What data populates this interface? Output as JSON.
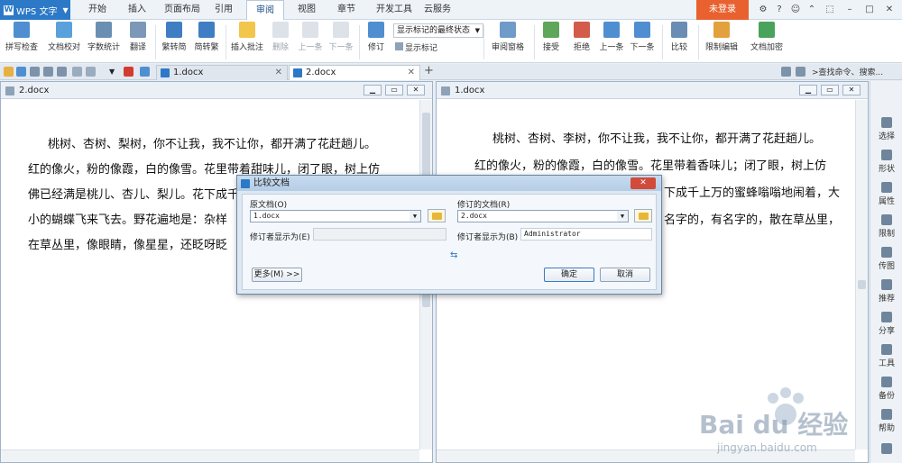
{
  "app": {
    "name": "WPS 文字",
    "login": "未登录"
  },
  "menu": [
    "开始",
    "插入",
    "页面布局",
    "引用",
    "审阅",
    "视图",
    "章节",
    "开发工具",
    "云服务"
  ],
  "menu_active": "审阅",
  "ribbon": {
    "spellcheck": "拼写检查",
    "doc_check": "文档校对",
    "word_count": "字数统计",
    "translate": "翻译",
    "to_simplified": "繁转简",
    "to_traditional": "简转繁",
    "insert_comment": "插入批注",
    "delete": "删除",
    "prev": "上一条",
    "next": "下一条",
    "track": "修订",
    "show_select": "显示标记的最终状态",
    "show_marks": "显示标记",
    "review_pane": "审阅窗格",
    "accept": "接受",
    "reject": "拒绝",
    "prev2": "上一条",
    "next2": "下一条",
    "compare": "比较",
    "restrict": "限制编辑",
    "encrypt": "文档加密"
  },
  "tabs": {
    "doc1": "1.docx",
    "doc2": "2.docx",
    "search": ">查找命令、搜索..."
  },
  "left_pane": {
    "title": "2.docx",
    "lines": [
      "桃树、杏树、梨树，你不让我，我不让你，都开满了花赶趟儿。",
      "红的像火，粉的像霞，白的像雪。花里带着甜味儿，闭了眼，树上仿",
      "佛已经满是桃儿、杏儿、梨儿。花下成千",
      "小的蝴蝶飞来飞去。野花遍地是：杂样",
      "在草丛里，像眼睛，像星星，还眨呀眨"
    ]
  },
  "right_pane": {
    "title": "1.docx",
    "lines": [
      "桃树、杏树、李树，你不让我，我不让你，都开满了花赶趟儿。",
      "红的像火，粉的像霞，白的像雪。花里带着香味儿；闭了眼，树上仿",
      "下成千上万的蜜蜂嗡嗡地闹着，大",
      "名字的，有名字的，散在草丛里，"
    ]
  },
  "sidepanel": [
    "选择",
    "形状",
    "属性",
    "限制",
    "传图",
    "推荐",
    "分享",
    "工具",
    "备份",
    "帮助"
  ],
  "dialog": {
    "title": "比较文档",
    "orig_label": "原文档(O)",
    "orig_value": "1.docx",
    "revised_label": "修订的文档(R)",
    "revised_value": "2.docx",
    "orig_author_label": "修订者显示为(E)",
    "orig_author_value": "",
    "revised_author_label": "修订者显示为(B)",
    "revised_author_value": "Administrator",
    "more": "更多(M) >>",
    "ok": "确定",
    "cancel": "取消"
  },
  "watermark": {
    "brand": "Bai du 经验",
    "url": "jingyan.baidu.com"
  }
}
